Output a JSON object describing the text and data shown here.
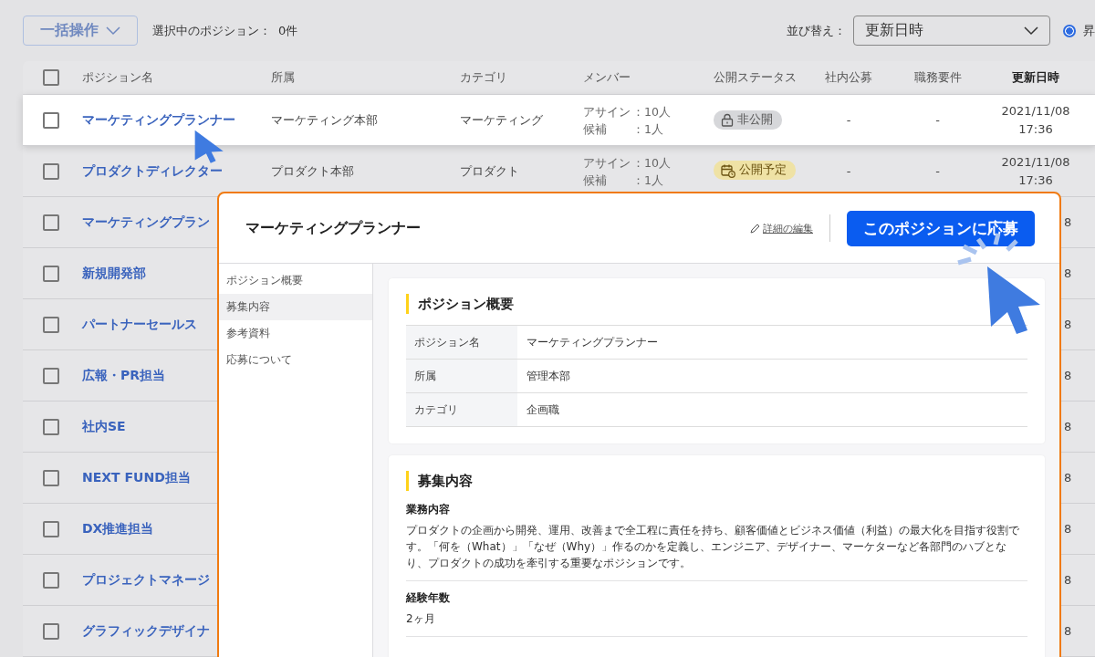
{
  "toolbar": {
    "bulk_button": "一括操作",
    "selection_label": "選択中のポジション：",
    "selection_count": "0件",
    "sort_label": "並び替え：",
    "sort_value": "更新日時",
    "order_option": {
      "label": "昇",
      "selected": true
    }
  },
  "table": {
    "header_checked": false,
    "columns": [
      {
        "label": "ポジション名",
        "sorted": false
      },
      {
        "label": "所属",
        "sorted": false
      },
      {
        "label": "カテゴリ",
        "sorted": false
      },
      {
        "label": "メンバー",
        "sorted": false
      },
      {
        "label": "公開ステータス",
        "sorted": false
      },
      {
        "label": "社内公募",
        "sorted": false
      },
      {
        "label": "職務要件",
        "sorted": false
      },
      {
        "label": "更新日時",
        "sorted": true
      }
    ],
    "rows": [
      {
        "kind": "full",
        "checked": false,
        "highlighted": true,
        "name": "マーケティングプランナー",
        "department": "マーケティング本部",
        "category": "マーケティング",
        "members": [
          {
            "label": "アサイン",
            "value": "：10人"
          },
          {
            "label": "候補",
            "value": "：1人"
          }
        ],
        "status": {
          "kind": "private",
          "label": "非公開"
        },
        "internal": "-",
        "requirement": "-",
        "updated": [
          "2021/11/08",
          "17:36"
        ]
      },
      {
        "kind": "full",
        "checked": false,
        "highlighted": false,
        "name": "プロダクトディレクター",
        "department": "プロダクト本部",
        "category": "プロダクト",
        "members": [
          {
            "label": "アサイン",
            "value": "：10人"
          },
          {
            "label": "候補",
            "value": "：1人"
          }
        ],
        "status": {
          "kind": "scheduled",
          "label": "公開予定"
        },
        "internal": "-",
        "requirement": "-",
        "updated": [
          "2021/11/08",
          "17:36"
        ]
      },
      {
        "kind": "covered",
        "checked": false,
        "highlighted": false,
        "name": "マーケティングプラン",
        "updated_tail": "8"
      },
      {
        "kind": "covered",
        "checked": false,
        "highlighted": false,
        "name": "新規開発部",
        "updated_tail": "8"
      },
      {
        "kind": "covered",
        "checked": false,
        "highlighted": false,
        "name": "パートナーセールス",
        "updated_tail": "8"
      },
      {
        "kind": "covered",
        "checked": false,
        "highlighted": false,
        "name": "広報・PR担当",
        "updated_tail": "8"
      },
      {
        "kind": "covered",
        "checked": false,
        "highlighted": false,
        "name": "社内SE",
        "updated_tail": "8"
      },
      {
        "kind": "covered",
        "checked": false,
        "highlighted": false,
        "name": "NEXT FUND担当",
        "updated_tail": "8"
      },
      {
        "kind": "covered",
        "checked": false,
        "highlighted": false,
        "name": "DX推進担当",
        "updated_tail": "8"
      },
      {
        "kind": "covered",
        "checked": false,
        "highlighted": false,
        "name": "プロジェクトマネージ",
        "updated_tail": "8"
      },
      {
        "kind": "covered",
        "checked": false,
        "highlighted": false,
        "name": "グラフィックデザイナ",
        "updated_tail": "8"
      }
    ]
  },
  "modal": {
    "title": "マーケティングプランナー",
    "edit_link": "詳細の編集",
    "apply_button": "このポジションに応募",
    "nav": [
      {
        "label": "ポジション概要",
        "selected": false
      },
      {
        "label": "募集内容",
        "selected": true
      },
      {
        "label": "参考資料",
        "selected": false
      },
      {
        "label": "応募について",
        "selected": false
      }
    ],
    "sections": [
      {
        "kind": "table",
        "title": "ポジション概要",
        "rows": [
          {
            "label": "ポジション名",
            "value": "マーケティングプランナー"
          },
          {
            "label": "所属",
            "value": "管理本部"
          },
          {
            "label": "カテゴリ",
            "value": "企画職"
          }
        ]
      },
      {
        "kind": "fields",
        "title": "募集内容",
        "fields": [
          {
            "label": "業務内容",
            "text": "プロダクトの企画から開発、運用、改善まで全工程に責任を持ち、顧客価値とビジネス価値（利益）の最大化を目指す役割です。「何を（What）」「なぜ（Why）」作るのかを定義し、エンジニア、デザイナー、マーケターなど各部門のハブとなり、プロダクトの成功を牽引する重要なポジションです。"
          },
          {
            "label": "経験年数",
            "text": "2ヶ月"
          }
        ]
      }
    ]
  }
}
